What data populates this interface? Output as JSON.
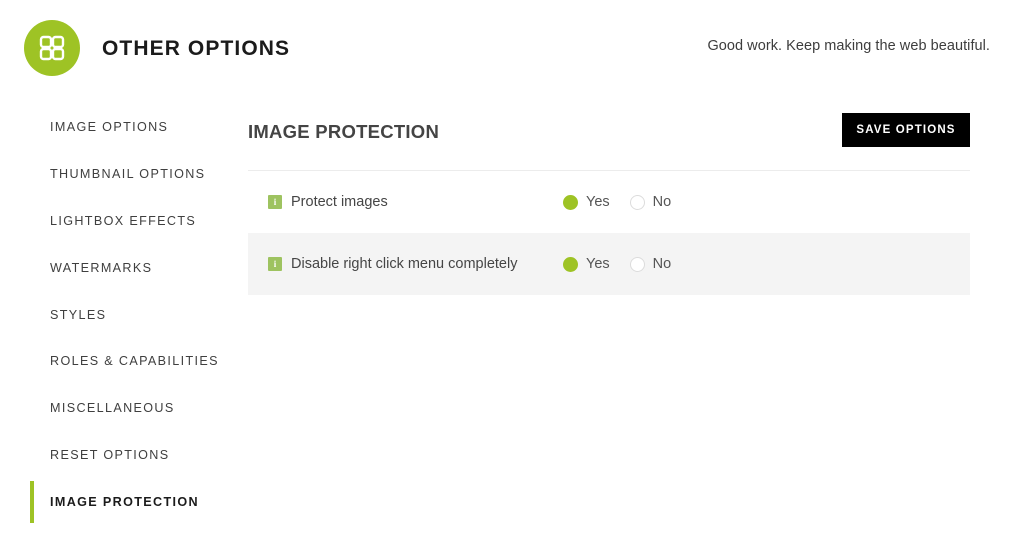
{
  "header": {
    "logo_icon": "grid-squares-icon",
    "title": "OTHER OPTIONS",
    "tagline": "Good work. Keep making the web beautiful."
  },
  "colors": {
    "accent_green": "#9ec325",
    "button_black": "#000000",
    "row_alt_background": "#f4f4f4",
    "info_icon_green": "#9ec360"
  },
  "sidebar": {
    "items": [
      {
        "label": "IMAGE OPTIONS",
        "active": false
      },
      {
        "label": "THUMBNAIL OPTIONS",
        "active": false
      },
      {
        "label": "LIGHTBOX EFFECTS",
        "active": false
      },
      {
        "label": "WATERMARKS",
        "active": false
      },
      {
        "label": "STYLES",
        "active": false
      },
      {
        "label": "ROLES & CAPABILITIES",
        "active": false
      },
      {
        "label": "MISCELLANEOUS",
        "active": false
      },
      {
        "label": "RESET OPTIONS",
        "active": false
      },
      {
        "label": "IMAGE PROTECTION",
        "active": true
      }
    ]
  },
  "main": {
    "section_title": "IMAGE PROTECTION",
    "save_button_label": "SAVE OPTIONS",
    "options": [
      {
        "info_icon": "info-icon",
        "label": "Protect images",
        "choices": [
          {
            "text": "Yes",
            "selected": true
          },
          {
            "text": "No",
            "selected": false
          }
        ]
      },
      {
        "info_icon": "info-icon",
        "label": "Disable right click menu completely",
        "choices": [
          {
            "text": "Yes",
            "selected": true
          },
          {
            "text": "No",
            "selected": false
          }
        ]
      }
    ]
  },
  "icon_glyphs": {
    "info": "i"
  }
}
